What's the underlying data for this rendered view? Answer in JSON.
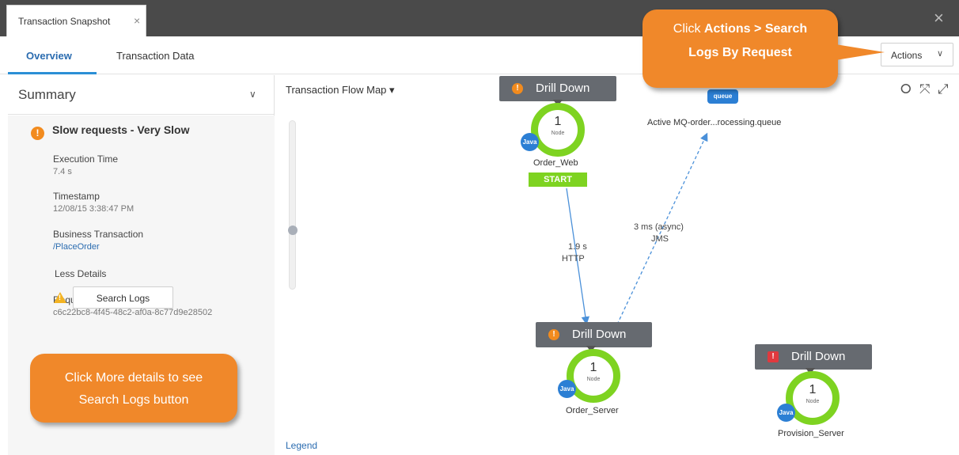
{
  "window": {
    "tab_label": "Transaction Snapshot",
    "tab_close": "×",
    "window_close": "×"
  },
  "subtabs": {
    "overview": "Overview",
    "transaction_data": "Transaction Data"
  },
  "actions": {
    "label": "Actions",
    "chevron": "∨"
  },
  "summary": {
    "title": "Summary",
    "chevron": "∨",
    "alert_icon": "!",
    "alert_title": "Slow requests - Very Slow",
    "fields": {
      "execution_time_label": "Execution Time",
      "execution_time_value": "7.4 s",
      "timestamp_label": "Timestamp",
      "timestamp_value": "12/08/15 3:38:47 PM",
      "business_transaction_label": "Business Transaction",
      "business_transaction_value": "/PlaceOrder",
      "less_details": "Less Details",
      "request_guid_label": "Request GUID",
      "request_guid_value": "c6c22bc8-4f45-48c2-af0a-8c77d9e28502"
    },
    "search_logs_label": "Search Logs",
    "warning_icon": "!"
  },
  "callouts": {
    "left_line1": "Click More details to see",
    "left_line2": "Search Logs button",
    "top_line1_prefix": "Click ",
    "top_line1_bold": "Actions > Search",
    "top_line2": "Logs By Request"
  },
  "flowmap": {
    "title": "Transaction Flow Map ▾",
    "legend": "Legend",
    "icons": {
      "fit": "⭘",
      "collapse": "⤧",
      "expand": "⤢"
    },
    "drill_label": "Drill Down",
    "node_count_label": "Node",
    "java_label": "Java",
    "nodes": {
      "order_web": {
        "name": "Order_Web",
        "count": "1",
        "badge": "START"
      },
      "order_server": {
        "name": "Order_Server",
        "count": "1"
      },
      "provision_server": {
        "name": "Provision_Server",
        "count": "1"
      }
    },
    "queue": {
      "icon_label": "queue",
      "name": "Active MQ-order...rocessing.queue"
    },
    "edges": {
      "http_time": "1.9 s",
      "http_type": "HTTP",
      "jms_time": "3 ms (async)",
      "jms_type": "JMS"
    }
  },
  "colors": {
    "accent_blue": "#2b6cb0",
    "callout_orange": "#f0882a",
    "node_green": "#7ed321",
    "drill_gray": "#666a70",
    "warning_orange": "#f28b1e",
    "error_red": "#e0393e"
  }
}
